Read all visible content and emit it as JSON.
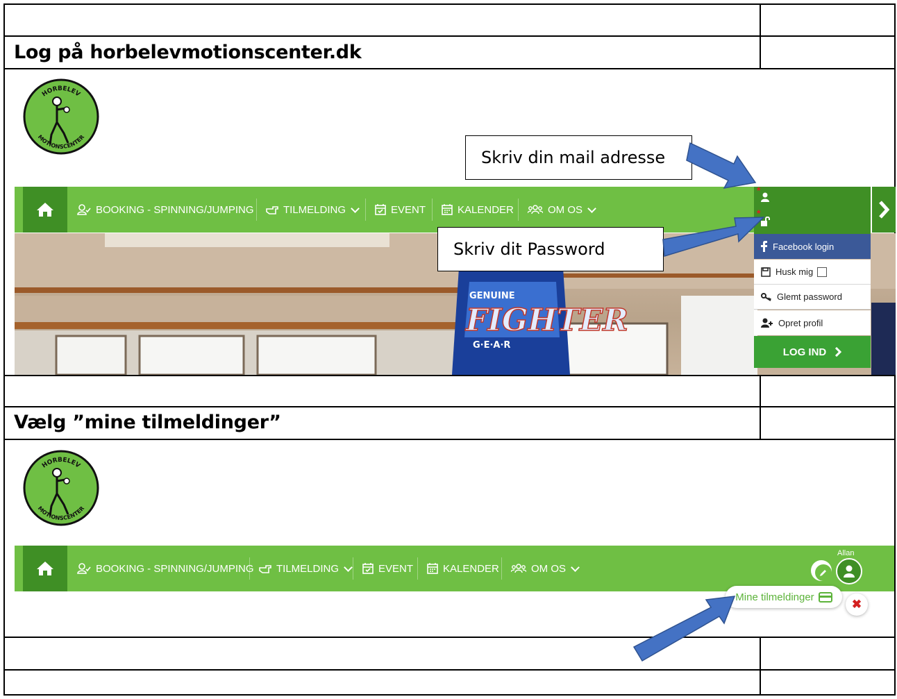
{
  "section1": {
    "heading": "Log på horbelevmotionscenter.dk",
    "callout_email": "Skriv din mail adresse",
    "callout_password": "Skriv dit Password"
  },
  "section2": {
    "heading": "Vælg ”mine tilmeldinger”"
  },
  "logo": {
    "top_text": "HORBELEV",
    "bottom_text": "MOTIONSCENTER",
    "color": "#6fbf44"
  },
  "nav": {
    "items": [
      {
        "label": "BOOKING - SPINNING/JUMPING",
        "icon": "user-check-icon"
      },
      {
        "label": "TILMELDING",
        "icon": "hand-point-icon"
      },
      {
        "label": "EVENT",
        "icon": "calendar-check-icon"
      },
      {
        "label": "KALENDER",
        "icon": "calendar-icon"
      },
      {
        "label": "OM OS",
        "icon": "users-icon"
      }
    ],
    "color": "#6fbf44",
    "dark": "#3f8f25"
  },
  "login_panel": {
    "facebook": "Facebook login",
    "remember": "Husk mig",
    "forgot": "Glemt password",
    "create": "Opret profil",
    "login_button": "LOG IND"
  },
  "user": {
    "name": "Allan",
    "my_registrations": "Mine tilmeldinger"
  },
  "photo_text": {
    "line1": "GENUINE",
    "line2": "FIGHTER",
    "line3": "G·E·A·R"
  }
}
